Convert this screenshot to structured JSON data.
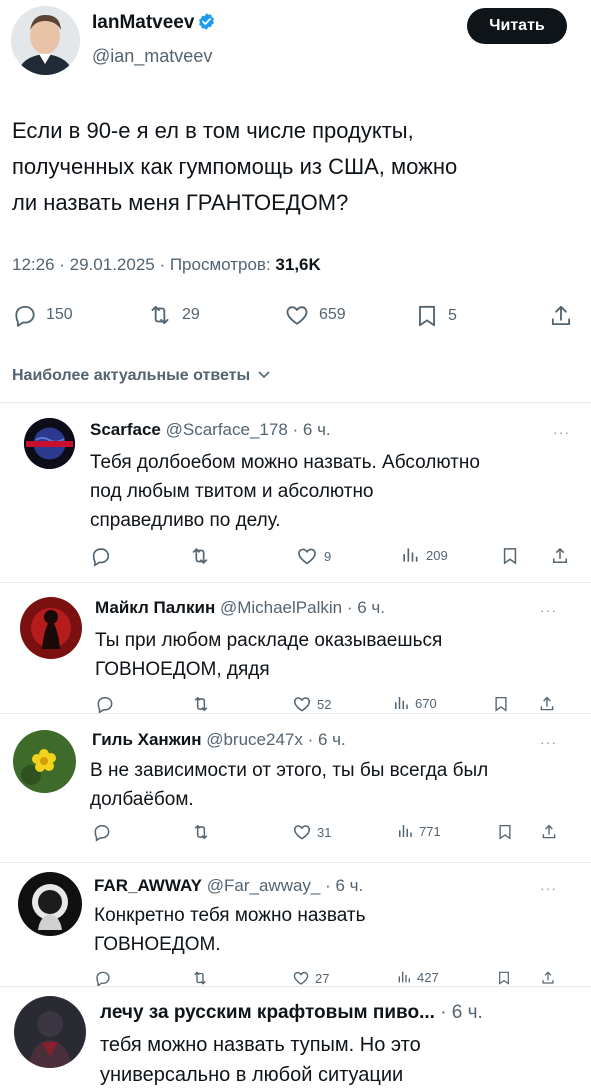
{
  "author": {
    "name": "IanMatveev",
    "handle": "@ian_matveev",
    "follow_label": "Читать"
  },
  "tweet": {
    "text_lines": [
      "Если в 90-е я ел в том числе продукты,",
      "полученных как гумпомощь из США, можно",
      "ли назвать меня ГРАНТОЕДОМ?"
    ],
    "meta_prefix": "12:26 · 29.01.2025 · Просмотров: ",
    "views": "31,6K",
    "replies": "150",
    "retweets": "29",
    "likes": "659",
    "bookmarks": "5"
  },
  "sort_label": "Наиболее актуальные ответы",
  "replies": [
    {
      "name": "Scarface",
      "handle": "@Scarface_178 · 6 ч.",
      "lines": [
        "Тебя долбоебом можно назвать. Абсолютно",
        "под любым твитом и абсолютно",
        "справедливо по делу."
      ],
      "replies": "",
      "retweets": "",
      "likes": "9",
      "views": "209",
      "avatar_text": "THE WORLD IS YOURS"
    },
    {
      "name": "Майкл Палкин",
      "handle": "@MichaelPalkin · 6 ч.",
      "lines": [
        "Ты при любом раскладе оказываешься",
        "ГОВНОЕДОМ, дядя"
      ],
      "replies": "",
      "retweets": "",
      "likes": "52",
      "views": "670"
    },
    {
      "name": "Гиль Ханжин",
      "handle": "@bruce247x · 6 ч.",
      "lines": [
        "В не зависимости от этого, ты бы всегда был",
        "долбаёбом."
      ],
      "replies": "",
      "retweets": "",
      "likes": "31",
      "views": "771"
    },
    {
      "name": "FAR_AWWAY",
      "handle": "@Far_awway_ · 6 ч.",
      "lines": [
        "Конкретно тебя можно назвать",
        "ГОВНОЕДОМ."
      ],
      "replies": "",
      "retweets": "",
      "likes": "27",
      "views": "427"
    },
    {
      "name": "лечу за русским крафтовым пиво...",
      "handle": "· 6 ч.",
      "lines": [
        "тебя можно назвать тупым. Но это",
        "универсально в любой ситуации"
      ]
    }
  ],
  "colors": {
    "text": "#0f1419",
    "muted": "#536471",
    "verified": "#1d9bf0",
    "follow_bg": "#0f1419"
  }
}
